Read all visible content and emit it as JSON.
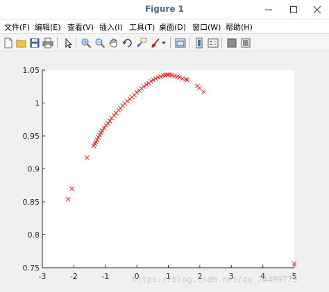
{
  "window": {
    "title": "Figure 1",
    "controls": [
      "minimize",
      "maximize",
      "close"
    ]
  },
  "menubar": {
    "items": [
      {
        "label": "文件(F)"
      },
      {
        "label": "编辑(E)"
      },
      {
        "label": "查看(V)"
      },
      {
        "label": "插入(I)"
      },
      {
        "label": "工具(T)"
      },
      {
        "label": "桌面(D)"
      },
      {
        "label": "窗口(W)"
      },
      {
        "label": "帮助(H)"
      }
    ]
  },
  "toolbar": {
    "icons": [
      "new-figure-icon",
      "open-file-icon",
      "save-icon",
      "print-icon",
      "edit-plot-icon",
      "zoom-in-icon",
      "zoom-out-icon",
      "pan-icon",
      "rotate-3d-icon",
      "data-cursor-icon",
      "brush-icon",
      "brush-dropdown-icon",
      "link-plot-icon",
      "insert-colorbar-icon",
      "insert-legend-icon",
      "hide-plot-tools-icon",
      "show-plot-tools-icon"
    ]
  },
  "watermark": "https://blog.csdn.net/qq_24409779",
  "colors": {
    "marker": "#e41a1c",
    "axes_bg": "#ffffff",
    "figure_bg": "#f0f0f0",
    "title": "#4a6a8a"
  },
  "chart_data": {
    "type": "scatter",
    "marker": "x",
    "xlim": [
      -3,
      5
    ],
    "ylim": [
      0.75,
      1.05
    ],
    "xticks": [
      "-3",
      "-2",
      "-1",
      "0",
      "1",
      "2",
      "3",
      "4",
      "5"
    ],
    "yticks": [
      "0.75",
      "0.8",
      "0.85",
      "0.9",
      "0.95",
      "1",
      "1.05"
    ],
    "grid": false,
    "points": [
      [
        -2.18,
        0.854
      ],
      [
        -2.06,
        0.87
      ],
      [
        -1.58,
        0.917
      ],
      [
        -1.37,
        0.935
      ],
      [
        -1.33,
        0.938
      ],
      [
        -1.3,
        0.941
      ],
      [
        -1.26,
        0.944
      ],
      [
        -1.22,
        0.948
      ],
      [
        -1.18,
        0.951
      ],
      [
        -1.14,
        0.955
      ],
      [
        -1.1,
        0.958
      ],
      [
        -1.04,
        0.962
      ],
      [
        -0.98,
        0.966
      ],
      [
        -0.92,
        0.969
      ],
      [
        -0.86,
        0.973
      ],
      [
        -0.8,
        0.977
      ],
      [
        -0.72,
        0.981
      ],
      [
        -0.66,
        0.985
      ],
      [
        -0.58,
        0.989
      ],
      [
        -0.52,
        0.992
      ],
      [
        -0.45,
        0.996
      ],
      [
        -0.38,
        0.999
      ],
      [
        -0.3,
        1.003
      ],
      [
        -0.22,
        1.006
      ],
      [
        -0.15,
        1.009
      ],
      [
        -0.08,
        1.012
      ],
      [
        0.0,
        1.016
      ],
      [
        0.08,
        1.019
      ],
      [
        0.15,
        1.022
      ],
      [
        0.22,
        1.025
      ],
      [
        0.3,
        1.028
      ],
      [
        0.38,
        1.03
      ],
      [
        0.45,
        1.033
      ],
      [
        0.52,
        1.035
      ],
      [
        0.6,
        1.037
      ],
      [
        0.68,
        1.039
      ],
      [
        0.76,
        1.04
      ],
      [
        0.84,
        1.042
      ],
      [
        0.9,
        1.042
      ],
      [
        0.95,
        1.043
      ],
      [
        1.0,
        1.043
      ],
      [
        1.06,
        1.043
      ],
      [
        1.12,
        1.042
      ],
      [
        1.2,
        1.041
      ],
      [
        1.28,
        1.04
      ],
      [
        1.36,
        1.039
      ],
      [
        1.45,
        1.037
      ],
      [
        1.55,
        1.036
      ],
      [
        1.6,
        1.035
      ],
      [
        1.92,
        1.026
      ],
      [
        1.98,
        1.023
      ],
      [
        2.12,
        1.017
      ],
      [
        5.0,
        0.756
      ]
    ]
  }
}
